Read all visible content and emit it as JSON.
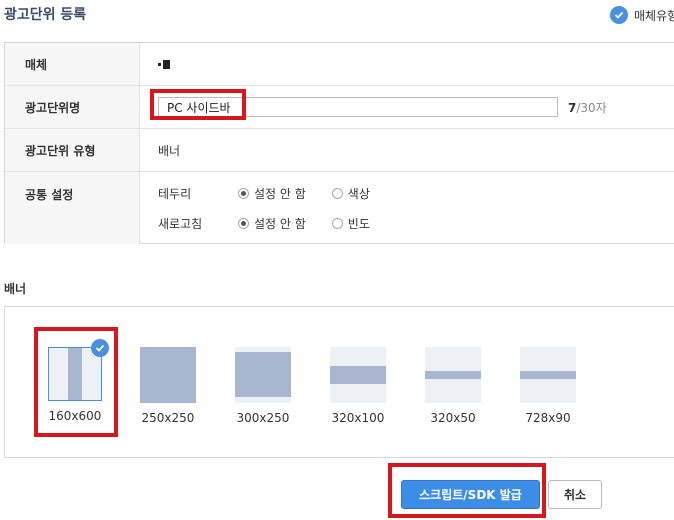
{
  "header": {
    "title": "광고단위 등록",
    "media_type_label": "매체유형"
  },
  "form": {
    "media": {
      "label": "매체"
    },
    "ad_unit_name": {
      "label": "광고단위명",
      "value": "PC 사이드바",
      "counter_current": "7",
      "counter_max": "/30자"
    },
    "ad_unit_type": {
      "label": "광고단위 유형",
      "value": "배너"
    },
    "common_settings": {
      "label": "공통 설정",
      "border": {
        "label": "테두리",
        "option_off": "설정 안 함",
        "option_on": "색상",
        "selected": "설정 안 함"
      },
      "refresh": {
        "label": "새로고침",
        "option_off": "설정 안 함",
        "option_on": "빈도",
        "selected": "설정 안 함"
      }
    }
  },
  "banner_section": {
    "title": "배너",
    "sizes": [
      {
        "label": "160x600",
        "selected": true
      },
      {
        "label": "250x250",
        "selected": false
      },
      {
        "label": "300x250",
        "selected": false
      },
      {
        "label": "320x100",
        "selected": false
      },
      {
        "label": "320x50",
        "selected": false
      },
      {
        "label": "728x90",
        "selected": false
      }
    ]
  },
  "actions": {
    "issue_label": "스크립트/SDK 발급",
    "cancel_label": "취소"
  },
  "colors": {
    "accent": "#3b8de6",
    "highlight_red": "#d7161d",
    "thumb_fill": "#a9b6cf",
    "thumb_bg": "#edf0f5"
  }
}
